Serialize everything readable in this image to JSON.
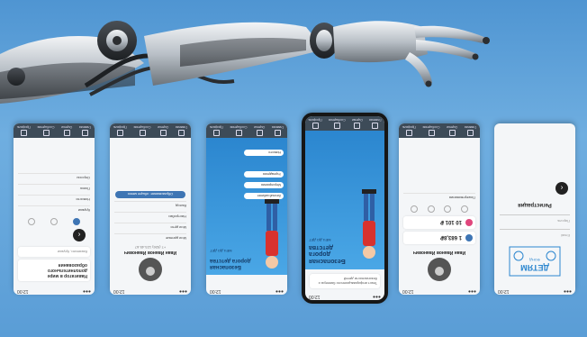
{
  "nav": [
    "Главная",
    "Оценки",
    "Сообщения",
    "Профиль"
  ],
  "screens": {
    "s1": {
      "title": "Навигатор в мире дополнительного образования",
      "search": "Вакансии, Кружки",
      "list": [
        "Кружки",
        "Новости",
        "Поиск",
        "Опросы"
      ]
    },
    "s2": {
      "name": "Иван Иванов Иванович",
      "sub": "+7 (926) 123-45-67",
      "rows": [
        "Мои данные",
        "Мои дети",
        "Настройки",
        "Выход"
      ],
      "button": "Образование: общее меню"
    },
    "s3": {
      "promo_title": "Безопасная дорога детства",
      "promo_sub": "МЕЧ ДО ДЕТ",
      "buttons": [
        "Личный кабинет",
        "Мероприятия",
        "Учреждения",
        "Новости"
      ]
    },
    "s4": {
      "promo_title": "Безопасная дорога детства",
      "promo_sub": "МЕЧ ДО ДЕТ",
      "note": "Текст информационного баннера о безопасности детей"
    },
    "s5": {
      "name": "Иван Иванов Иванович",
      "balance1": "1 683,8₽",
      "balance2": "10 101 ₽",
      "label": "Пожертвования"
    },
    "s6": {
      "logo": "ДЕТЯМ",
      "logo_sub": "ФОНД",
      "email": "Email",
      "password": "Пароль",
      "title": "Регистрация"
    }
  }
}
